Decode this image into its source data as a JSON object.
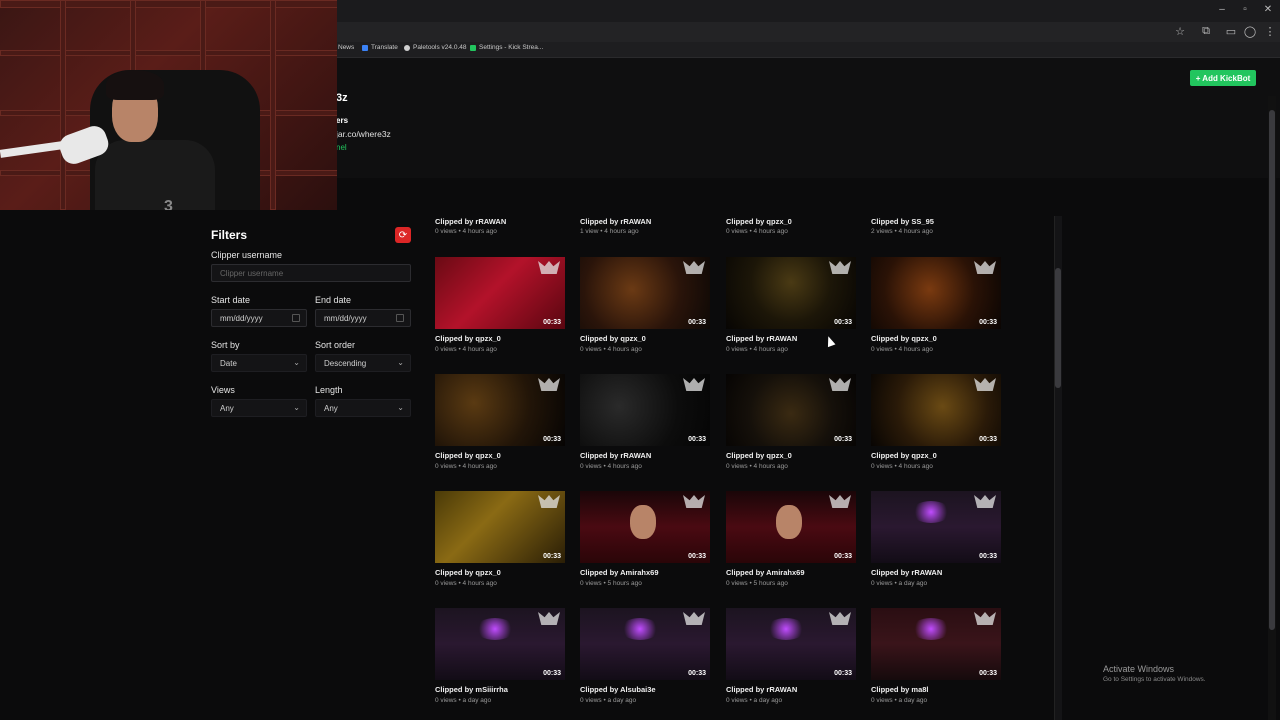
{
  "browser": {
    "bookmarks": [
      {
        "label": "News",
        "color": "#3b82f6"
      },
      {
        "label": "Translate",
        "color": "#3b82f6"
      },
      {
        "label": "Paletools v24.0.48",
        "color": "#22c55e"
      },
      {
        "label": "Settings - Kick Strea...",
        "color": "#22c55e"
      }
    ]
  },
  "header": {
    "channel_name": "3z",
    "sub": "ers",
    "link": "jar.co/where3z",
    "tag": "nel",
    "add_kickbot": "+ Add KickBot"
  },
  "webcam": {
    "logo": "3"
  },
  "filters": {
    "title": "Filters",
    "reset_icon": "⟳",
    "clipper_label": "Clipper username",
    "clipper_placeholder": "Clipper username",
    "start_label": "Start date",
    "start_value": "mm/dd/yyyy",
    "end_label": "End date",
    "end_value": "mm/dd/yyyy",
    "sortby_label": "Sort by",
    "sortby_value": "Date",
    "sortorder_label": "Sort order",
    "sortorder_value": "Descending",
    "views_label": "Views",
    "views_value": "Any",
    "length_label": "Length",
    "length_value": "Any"
  },
  "top_row": [
    {
      "by": "Clipped by rRAWAN",
      "meta": "0 views • 4 hours ago"
    },
    {
      "by": "Clipped by rRAWAN",
      "meta": "1 view • 4 hours ago"
    },
    {
      "by": "Clipped by qpzx_0",
      "meta": "0 views • 4 hours ago"
    },
    {
      "by": "Clipped by SS_95",
      "meta": "2 views • 4 hours ago"
    }
  ],
  "clips": [
    {
      "by": "Clipped by qpzx_0",
      "meta": "0 views • 4 hours ago",
      "duration": "00:33",
      "theme": "t-red"
    },
    {
      "by": "Clipped by qpzx_0",
      "meta": "0 views • 4 hours ago",
      "duration": "00:33",
      "theme": "t-hall1"
    },
    {
      "by": "Clipped by rRAWAN",
      "meta": "0 views • 4 hours ago",
      "duration": "00:33",
      "theme": "t-hall2"
    },
    {
      "by": "Clipped by qpzx_0",
      "meta": "0 views • 4 hours ago",
      "duration": "00:33",
      "theme": "t-hall3"
    },
    {
      "by": "Clipped by qpzx_0",
      "meta": "0 views • 4 hours ago",
      "duration": "00:33",
      "theme": "t-hall4"
    },
    {
      "by": "Clipped by rRAWAN",
      "meta": "0 views • 4 hours ago",
      "duration": "00:33",
      "theme": "t-dark"
    },
    {
      "by": "Clipped by qpzx_0",
      "meta": "0 views • 4 hours ago",
      "duration": "00:33",
      "theme": "t-hall5"
    },
    {
      "by": "Clipped by qpzx_0",
      "meta": "0 views • 4 hours ago",
      "duration": "00:33",
      "theme": "t-hall6"
    },
    {
      "by": "Clipped by qpzx_0",
      "meta": "0 views • 4 hours ago",
      "duration": "00:33",
      "theme": "t-hall7"
    },
    {
      "by": "Clipped by Amirahx69",
      "meta": "0 views • 5 hours ago",
      "duration": "00:33",
      "theme": "t-stream"
    },
    {
      "by": "Clipped by Amirahx69",
      "meta": "0 views • 5 hours ago",
      "duration": "00:33",
      "theme": "t-stream"
    },
    {
      "by": "Clipped by rRAWAN",
      "meta": "0 views • a day ago",
      "duration": "00:33",
      "theme": "t-room"
    },
    {
      "by": "Clipped by mSiiirrha",
      "meta": "0 views • a day ago",
      "duration": "00:33",
      "theme": "t-room"
    },
    {
      "by": "Clipped by Alsubai3e",
      "meta": "0 views • a day ago",
      "duration": "00:33",
      "theme": "t-room"
    },
    {
      "by": "Clipped by rRAWAN",
      "meta": "0 views • a day ago",
      "duration": "00:33",
      "theme": "t-room"
    },
    {
      "by": "Clipped by ma8l",
      "meta": "0 views • a day ago",
      "duration": "00:33",
      "theme": "t-room2"
    }
  ],
  "windows": {
    "activate_title": "Activate Windows",
    "activate_sub": "Go to Settings to activate Windows."
  },
  "colors": {
    "accent": "#22c55e",
    "danger": "#dc2626",
    "background": "#0b0b0c"
  }
}
